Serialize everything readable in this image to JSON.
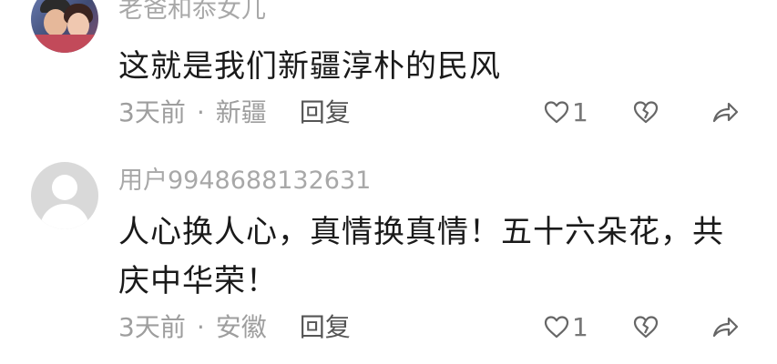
{
  "comments": [
    {
      "username": "老爸和忝女儿",
      "text": "这就是我们新疆淳朴的民风",
      "time": "3天前",
      "location": "新疆",
      "reply_label": "回复",
      "like_count": "1",
      "avatar_type": "photo"
    },
    {
      "username": "用户9948688132631",
      "text": "人心换人心，真情换真情！五十六朵花，共庆中华荣！",
      "time": "3天前",
      "location": "安徽",
      "reply_label": "回复",
      "like_count": "1",
      "avatar_type": "default-user"
    }
  ],
  "separator": "·",
  "icons": {
    "like": "heart-outline-icon",
    "dislike": "broken-heart-icon",
    "share": "share-arrow-icon"
  }
}
